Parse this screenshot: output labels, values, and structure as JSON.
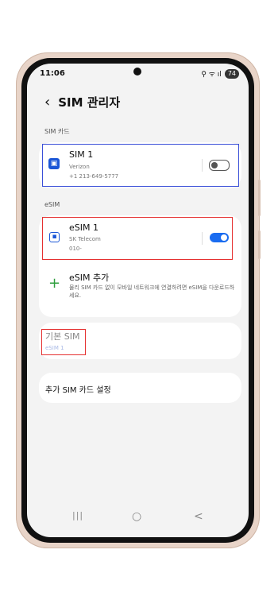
{
  "status": {
    "time": "11:06",
    "icons": "⚲ ᯤ ıl",
    "battery": "74"
  },
  "header": {
    "back": "‹",
    "title": "SIM 관리자"
  },
  "sim_section": {
    "label": "SIM 카드",
    "item": {
      "title": "SIM 1",
      "carrier": "Verizon",
      "number": "+1 213-649-5777",
      "enabled": false
    }
  },
  "esim_section": {
    "label": "eSIM",
    "item": {
      "title": "eSIM 1",
      "carrier": "SK Telecom",
      "number": "010-",
      "enabled": true
    },
    "add": {
      "title": "eSIM 추가",
      "description": "물리 SIM 카드 없이 모바일 네트워크에 연결하려면 eSIM을 다운로드하세요."
    }
  },
  "default_sim": {
    "title": "기본 SIM",
    "value": "eSIM 1"
  },
  "extra_settings": {
    "title": "추가 SIM 카드 설정"
  },
  "nav": {
    "recents": "|||",
    "home": "○",
    "back": "<"
  },
  "colors": {
    "accent": "#1a6cf0",
    "highlight_blue": "#3a4fd8",
    "highlight_red": "#e53030",
    "add_icon": "#2e9e3e"
  }
}
